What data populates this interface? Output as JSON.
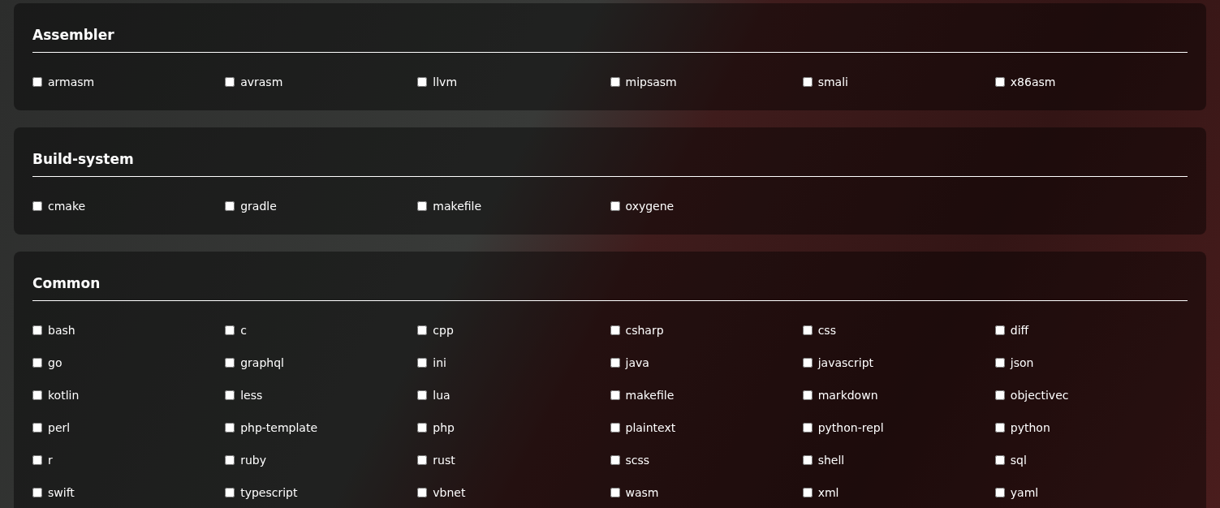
{
  "sections": [
    {
      "title": "Assembler",
      "items": [
        {
          "label": "armasm",
          "checked": false
        },
        {
          "label": "avrasm",
          "checked": false
        },
        {
          "label": "llvm",
          "checked": false
        },
        {
          "label": "mipsasm",
          "checked": false
        },
        {
          "label": "smali",
          "checked": false
        },
        {
          "label": "x86asm",
          "checked": false
        }
      ]
    },
    {
      "title": "Build-system",
      "items": [
        {
          "label": "cmake",
          "checked": false
        },
        {
          "label": "gradle",
          "checked": false
        },
        {
          "label": "makefile",
          "checked": false
        },
        {
          "label": "oxygene",
          "checked": false
        }
      ]
    },
    {
      "title": "Common",
      "items": [
        {
          "label": "bash",
          "checked": false
        },
        {
          "label": "c",
          "checked": false
        },
        {
          "label": "cpp",
          "checked": false
        },
        {
          "label": "csharp",
          "checked": false
        },
        {
          "label": "css",
          "checked": false
        },
        {
          "label": "diff",
          "checked": false
        },
        {
          "label": "go",
          "checked": false
        },
        {
          "label": "graphql",
          "checked": false
        },
        {
          "label": "ini",
          "checked": false
        },
        {
          "label": "java",
          "checked": false
        },
        {
          "label": "javascript",
          "checked": false
        },
        {
          "label": "json",
          "checked": false
        },
        {
          "label": "kotlin",
          "checked": false
        },
        {
          "label": "less",
          "checked": false
        },
        {
          "label": "lua",
          "checked": false
        },
        {
          "label": "makefile",
          "checked": false
        },
        {
          "label": "markdown",
          "checked": false
        },
        {
          "label": "objectivec",
          "checked": false
        },
        {
          "label": "perl",
          "checked": false
        },
        {
          "label": "php-template",
          "checked": false
        },
        {
          "label": "php",
          "checked": false
        },
        {
          "label": "plaintext",
          "checked": false
        },
        {
          "label": "python-repl",
          "checked": false
        },
        {
          "label": "python",
          "checked": false
        },
        {
          "label": "r",
          "checked": false
        },
        {
          "label": "ruby",
          "checked": false
        },
        {
          "label": "rust",
          "checked": false
        },
        {
          "label": "scss",
          "checked": false
        },
        {
          "label": "shell",
          "checked": false
        },
        {
          "label": "sql",
          "checked": false
        },
        {
          "label": "swift",
          "checked": false
        },
        {
          "label": "typescript",
          "checked": false
        },
        {
          "label": "vbnet",
          "checked": false
        },
        {
          "label": "wasm",
          "checked": false
        },
        {
          "label": "xml",
          "checked": false
        },
        {
          "label": "yaml",
          "checked": false
        }
      ]
    }
  ]
}
